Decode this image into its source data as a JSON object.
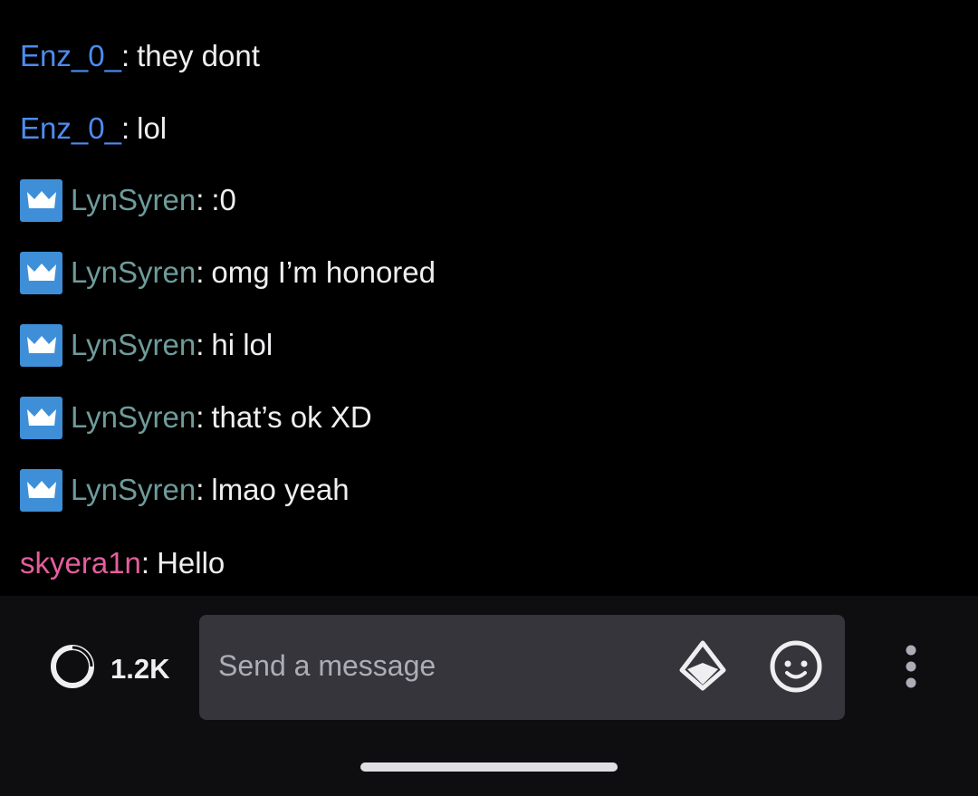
{
  "colors": {
    "enz": "#4d8cf0",
    "lyn": "#6f9b9b",
    "skye": "#e45e9d",
    "text": "#efeff1",
    "badge": "#3e8fd7"
  },
  "messages": [
    {
      "user": "Enz_0_",
      "sep": ":",
      "text": "they dont",
      "badge": false,
      "color": "#4d8cf0"
    },
    {
      "user": "Enz_0_",
      "sep": ":",
      "text": "lol",
      "badge": false,
      "color": "#4d8cf0"
    },
    {
      "user": "LynSyren",
      "sep": ":",
      "text": ":0",
      "badge": true,
      "color": "#6f9b9b"
    },
    {
      "user": "LynSyren",
      "sep": ":",
      "text": "omg I’m honored",
      "badge": true,
      "color": "#6f9b9b"
    },
    {
      "user": "LynSyren",
      "sep": ":",
      "text": "hi lol",
      "badge": true,
      "color": "#6f9b9b"
    },
    {
      "user": "LynSyren",
      "sep": ":",
      "text": "that’s ok XD",
      "badge": true,
      "color": "#6f9b9b"
    },
    {
      "user": "LynSyren",
      "sep": ":",
      "text": "lmao yeah",
      "badge": true,
      "color": "#6f9b9b"
    },
    {
      "user": "skyera1n",
      "sep": ":",
      "text": "Hello",
      "badge": false,
      "color": "#e45e9d"
    }
  ],
  "bottom_bar": {
    "viewer_count": "1.2K",
    "input_placeholder": "Send a message",
    "icons": {
      "viewers": "viewers-icon",
      "bits": "bits-icon",
      "emote": "emote-icon",
      "more": "more-vertical-icon"
    }
  }
}
